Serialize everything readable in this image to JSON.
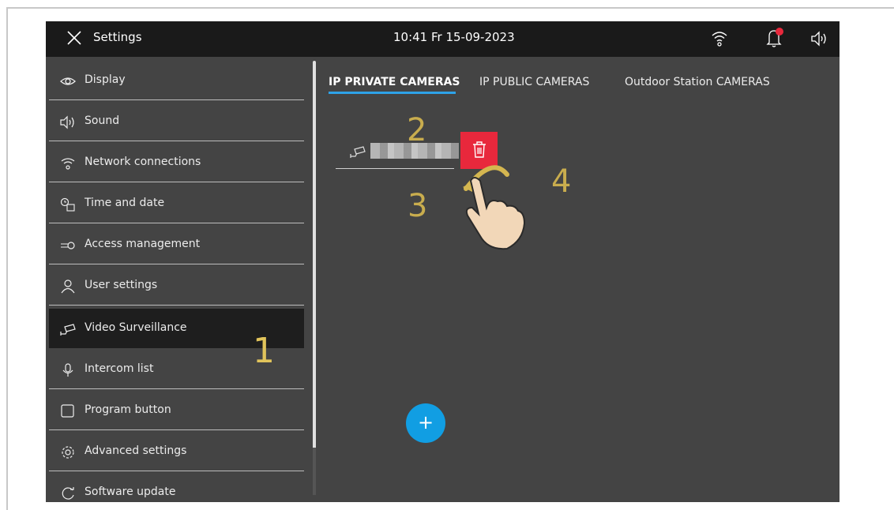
{
  "topbar": {
    "title": "Settings",
    "clock": "10:41  Fr 15-09-2023",
    "icons": [
      "close-icon",
      "wifi-icon",
      "bell-icon",
      "speaker-icon"
    ],
    "notification_dot_color": "#e8283c"
  },
  "sidebar": {
    "items": [
      {
        "label": "Display",
        "icon": "eye-icon"
      },
      {
        "label": "Sound",
        "icon": "speaker-icon"
      },
      {
        "label": "Network connections",
        "icon": "wifi-icon"
      },
      {
        "label": "Time and date",
        "icon": "clock-calendar-icon"
      },
      {
        "label": "Access  management",
        "icon": "key-icon"
      },
      {
        "label": "User settings",
        "icon": "user-icon"
      },
      {
        "label": "Video Surveillance",
        "icon": "camera-icon",
        "active": true
      },
      {
        "label": "Intercom list",
        "icon": "microphone-icon"
      },
      {
        "label": "Program button",
        "icon": "square-icon"
      },
      {
        "label": "Advanced settings",
        "icon": "gear-icon"
      },
      {
        "label": "Software update",
        "icon": "refresh-icon"
      }
    ]
  },
  "tabs": [
    {
      "label": "IP PRIVATE CAMERAS",
      "active": true
    },
    {
      "label": "IP PUBLIC CAMERAS",
      "active": false
    },
    {
      "label": "Outdoor Station CAMERAS",
      "active": false
    }
  ],
  "camera_list": {
    "items": [
      {
        "icon": "camera-icon",
        "name_obscured": true
      }
    ],
    "delete_icon": "trash-icon",
    "delete_color": "#e8283c"
  },
  "fab": {
    "label": "+",
    "color": "#119ee3"
  },
  "annotations": {
    "step1": "1",
    "step2": "2",
    "step3": "3",
    "step4": "4",
    "color": "#d4b650"
  },
  "accent_color": "#2ea3e8"
}
